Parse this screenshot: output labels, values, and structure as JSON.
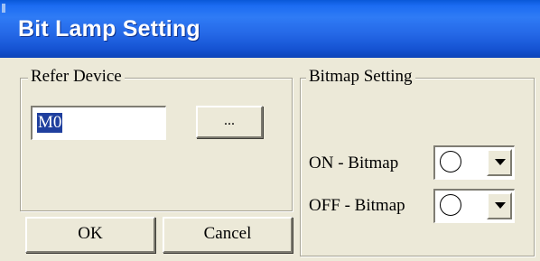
{
  "window": {
    "title": "Bit Lamp Setting"
  },
  "refer_device": {
    "group_label": "Refer Device",
    "device_value": "M0",
    "browse_label": "..."
  },
  "bitmap_setting": {
    "group_label": "Bitmap Setting",
    "on_label": "ON - Bitmap",
    "off_label": "OFF - Bitmap",
    "on_selected_icon": "empty-circle-icon",
    "off_selected_icon": "empty-circle-icon"
  },
  "buttons": {
    "ok_label": "OK",
    "cancel_label": "Cancel"
  },
  "colors": {
    "title_bar": "#2467e6",
    "dialog_background": "#ece9d8",
    "selection_highlight": "#1f3f9e"
  }
}
